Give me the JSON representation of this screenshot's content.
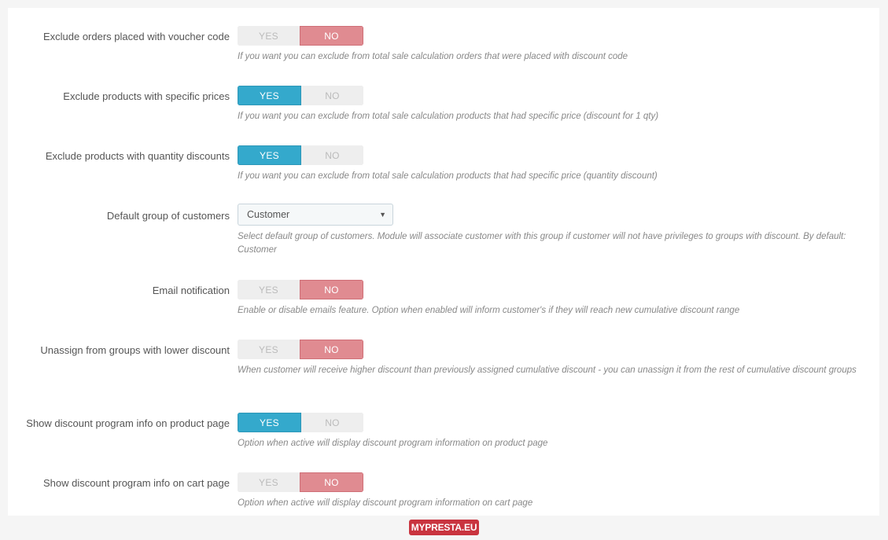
{
  "settings": [
    {
      "label": "Exclude orders placed with voucher code",
      "type": "switch",
      "value": "NO",
      "yes_label": "YES",
      "no_label": "NO",
      "help": "If you want you can exclude from total sale calculation orders that were placed with discount code"
    },
    {
      "label": "Exclude products with specific prices",
      "type": "switch",
      "value": "YES",
      "yes_label": "YES",
      "no_label": "NO",
      "help": "If you want you can exclude from total sale calculation products that had specific price (discount for 1 qty)"
    },
    {
      "label": "Exclude products with quantity discounts",
      "type": "switch",
      "value": "YES",
      "yes_label": "YES",
      "no_label": "NO",
      "help": "If you want you can exclude from total sale calculation products that had specific price (quantity discount)"
    },
    {
      "label": "Default group of customers",
      "type": "select",
      "value": "Customer",
      "help": "Select default group of customers. Module will associate customer with this group if customer will not have privileges to groups with discount. By default: Customer"
    },
    {
      "label": "Email notification",
      "type": "switch",
      "value": "NO",
      "yes_label": "YES",
      "no_label": "NO",
      "help": "Enable or disable emails feature. Option when enabled will inform customer's if they will reach new cumulative discount range"
    },
    {
      "label": "Unassign from groups with lower discount",
      "type": "switch",
      "value": "NO",
      "yes_label": "YES",
      "no_label": "NO",
      "help": "When customer will receive higher discount than previously assigned cumulative discount - you can unassign it from the rest of cumulative discount groups"
    },
    {
      "label": "Show discount program info on product page",
      "type": "switch",
      "value": "YES",
      "yes_label": "YES",
      "no_label": "NO",
      "help": "Option when active will display discount program information on product page"
    },
    {
      "label": "Show discount program info on cart page",
      "type": "switch",
      "value": "NO",
      "yes_label": "YES",
      "no_label": "NO",
      "help": "Option when active will display discount program information on cart page"
    }
  ],
  "footer": {
    "brand": "MYPRESTA.EU"
  },
  "colors": {
    "yes_active": "#34a9cc",
    "no_active": "#e08b91",
    "brand": "#c9343f"
  }
}
